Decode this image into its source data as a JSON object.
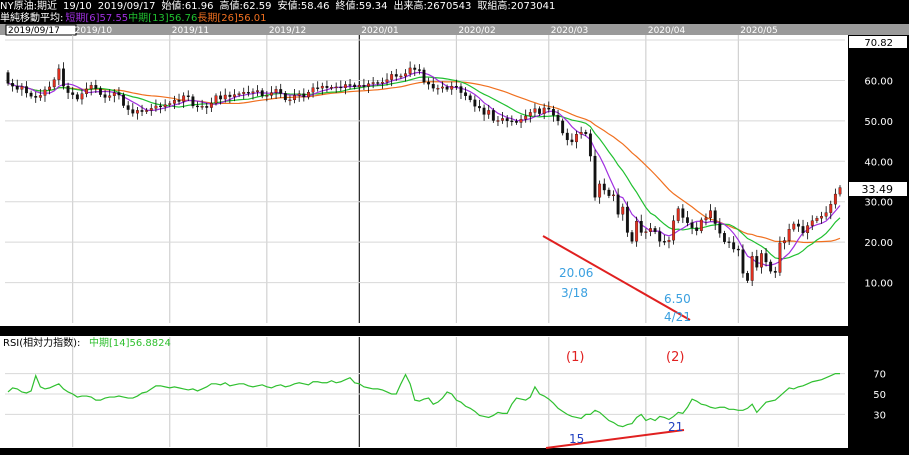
{
  "header": {
    "symbol": "NY原油:期近",
    "period": "19/10",
    "date": "2019/09/17",
    "open_label": "始値",
    "open": "61.96",
    "high_label": "高値",
    "high": "62.59",
    "low_label": "安値",
    "low": "58.46",
    "close_label": "終値",
    "close": "59.34",
    "volume_label": "出来高",
    "volume": "2670543",
    "oi_label": "取組高",
    "oi": "2073041"
  },
  "ma_legend": {
    "title": "単純移動平均:",
    "short": "短期[6]57.55",
    "mid": "中期[13]56.76",
    "long": "長期[26]56.01"
  },
  "rsi_legend": {
    "title": "RSI(相対力指数):",
    "value": "中期[14]56.8824"
  },
  "colors": {
    "up": "#e03020",
    "down": "#111111",
    "short_ma": "#a030e0",
    "mid_ma": "#20c030",
    "long_ma": "#f07020",
    "rsi": "#30c030",
    "annot_line": "#e02020",
    "annot_text": "#3aa0e0",
    "rsi_annot_text": "#2040c0",
    "paren_text": "#e02020"
  },
  "chart_data": [
    {
      "type": "candlestick",
      "title": "NY原油:期近",
      "x_dates": [
        "2019/09/17",
        "2019/10",
        "2019/11",
        "2019/12",
        "2020/01",
        "2020/02",
        "2020/03",
        "2020/04",
        "2020/05"
      ],
      "x_tick_labels": [
        "2019/09/17",
        "2019/10",
        "2019/11",
        "2019/12",
        "2020/01",
        "2020/02",
        "2020/03",
        "2020/04",
        "2020/05"
      ],
      "y_ticks": [
        10,
        20,
        30,
        40,
        50,
        60,
        70
      ],
      "y_tick_labels": [
        "10.00",
        "20.00",
        "30.00",
        "40.00",
        "50.00",
        "60.00",
        ""
      ],
      "ylim": [
        0,
        71
      ],
      "y_top_label": "70.82",
      "last_price_label": "33.49",
      "close_series": [
        59.3,
        58.6,
        57.8,
        58.5,
        56.9,
        56.1,
        55.8,
        56.3,
        57.7,
        58.4,
        60.2,
        62.9,
        58.6,
        57.0,
        56.5,
        55.4,
        56.7,
        57.9,
        58.8,
        58.0,
        56.5,
        55.8,
        56.2,
        57.0,
        56.4,
        53.8,
        52.8,
        51.9,
        52.6,
        52.3,
        52.6,
        53.1,
        53.7,
        53.5,
        54.0,
        54.3,
        55.1,
        54.8,
        56.2,
        56.0,
        53.7,
        53.6,
        53.6,
        53.3,
        54.4,
        56.2,
        55.4,
        56.4,
        56.0,
        56.5,
        56.7,
        57.1,
        56.9,
        57.2,
        57.5,
        56.2,
        56.3,
        57.0,
        57.8,
        56.8,
        55.2,
        55.2,
        56.3,
        56.7,
        55.9,
        57.1,
        58.2,
        58.1,
        58.6,
        58.2,
        58.3,
        58.4,
        58.2,
        59.0,
        58.9,
        58.4,
        58.8,
        58.5,
        59.2,
        59.5,
        59.3,
        59.6,
        60.2,
        61.5,
        61.0,
        61.1,
        61.7,
        63.1,
        62.7,
        62.6,
        59.6,
        59.1,
        58.1,
        58.1,
        58.4,
        57.8,
        58.6,
        58.5,
        57.0,
        56.2,
        55.2,
        53.6,
        53.2,
        51.6,
        52.6,
        50.1,
        50.1,
        50.6,
        50.0,
        49.9,
        49.6,
        50.4,
        51.2,
        52.1,
        53.0,
        51.8,
        53.2,
        52.9,
        51.4,
        50.0,
        47.0,
        45.3,
        44.8,
        46.7,
        47.2,
        46.8,
        41.3,
        31.1,
        34.4,
        32.9,
        31.5,
        31.7,
        26.9,
        28.7,
        22.4,
        20.2,
        25.2,
        22.4,
        22.6,
        23.4,
        22.6,
        20.2,
        20.1,
        20.5,
        25.3,
        28.3,
        26.1,
        24.8,
        23.6,
        22.8,
        25.5,
        26.0,
        27.8,
        24.6,
        22.2,
        20.1,
        19.9,
        18.3,
        18.1,
        12.3,
        10.5,
        16.5,
        13.8,
        17.2,
        15.1,
        12.8,
        12.5,
        19.8,
        20.4,
        23.2,
        24.5,
        23.9,
        22.3,
        24.1,
        25.3,
        25.9,
        26.4,
        27.3,
        29.4,
        31.9,
        33.5
      ],
      "ma_short_label": "短期[6]57.55",
      "ma_mid_label": "中期[13]56.76",
      "ma_long_label": "長期[26]56.01",
      "annotations": [
        {
          "text": "20.06",
          "color": "#3aa0e0"
        },
        {
          "text": "3/18",
          "color": "#3aa0e0"
        },
        {
          "text": "6.50",
          "color": "#3aa0e0"
        },
        {
          "text": "4/21",
          "color": "#3aa0e0"
        }
      ]
    },
    {
      "type": "line",
      "title": "RSI(相対力指数):中期[14]56.8824",
      "y_ticks": [
        30,
        50,
        70
      ],
      "y_tick_labels": [
        "30",
        "50",
        "70"
      ],
      "ylim": [
        0,
        100
      ],
      "series": [
        {
          "name": "中期[14]",
          "values": [
            52,
            56,
            55,
            52,
            51,
            53,
            68,
            57,
            55,
            56,
            58,
            60,
            55,
            52,
            50,
            47,
            48,
            48,
            47,
            44,
            44,
            46,
            47,
            47,
            48,
            47,
            46,
            46,
            48,
            51,
            52,
            55,
            58,
            58,
            57,
            56,
            57,
            56,
            55,
            54,
            55,
            53,
            55,
            57,
            60,
            60,
            59,
            61,
            58,
            59,
            60,
            60,
            58,
            57,
            58,
            59,
            57,
            56,
            58,
            59,
            57,
            58,
            60,
            61,
            60,
            59,
            62,
            62,
            61,
            61,
            63,
            61,
            62,
            64,
            66,
            61,
            60,
            57,
            56,
            55,
            55,
            54,
            52,
            50,
            50,
            60,
            69,
            60,
            44,
            43,
            45,
            46,
            40,
            42,
            46,
            52,
            50,
            44,
            42,
            38,
            36,
            33,
            29,
            28,
            27,
            29,
            32,
            31,
            31,
            40,
            46,
            45,
            44,
            47,
            57,
            50,
            48,
            45,
            41,
            36,
            33,
            30,
            28,
            27,
            26,
            30,
            30,
            34,
            32,
            28,
            24,
            22,
            19,
            18,
            20,
            21,
            27,
            30,
            24,
            26,
            24,
            28,
            27,
            25,
            28,
            32,
            31,
            37,
            45,
            43,
            40,
            39,
            37,
            36,
            37,
            37,
            35,
            35,
            34,
            34,
            36,
            40,
            32,
            37,
            42,
            43,
            44,
            48,
            52,
            56,
            55,
            57,
            58,
            60,
            62,
            63,
            64,
            66,
            68,
            70,
            70
          ]
        }
      ],
      "annotations": [
        {
          "text": "(1)",
          "color": "#e02020"
        },
        {
          "text": "(2)",
          "color": "#e02020"
        },
        {
          "text": "15",
          "color": "#2040c0"
        },
        {
          "text": "21",
          "color": "#2040c0"
        }
      ]
    }
  ]
}
